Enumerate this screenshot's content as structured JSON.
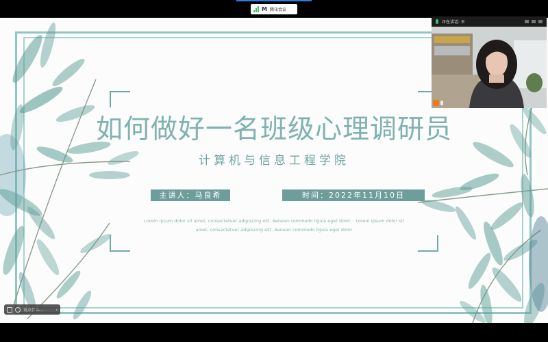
{
  "meeting_bar": {
    "app_name": "腾讯会议",
    "logo_glyph": "M",
    "icons": {
      "signal": "signal-icon",
      "logo": "tencent-meeting-logo-icon"
    },
    "accent_color": "#2f7de1"
  },
  "slide": {
    "title": "如何做好一名班级心理调研员",
    "subtitle": "计算机与信息工程学院",
    "speaker_label": "主讲人：马良希",
    "date_label": "时间：2022年11月10日",
    "lorem_line_1": "Lorem ipsum dolor sit amet, consectetuer adipiscing elit. Aenean commodo ligula eget dolor. . Lorem ipsum dolor sit",
    "lorem_line_2": "amet, consectetuer adipiscing elit. Aenean commodo ligula eget dolor",
    "colors": {
      "title": "#7fb2b1",
      "label_bg": "#6e9e9c",
      "frame": "#8fc6c2",
      "leaf": "#5f9e98"
    }
  },
  "video_panel": {
    "speaking_text": "正在讲话: 王",
    "participant_name": "",
    "icons": {
      "mic": "mic-icon",
      "user": "user-icon"
    }
  },
  "toolbar": {
    "chat_placeholder": "说点什么...",
    "collapse_glyph": "‹",
    "icons": [
      "screen-icon",
      "chat-icon",
      "collapse-icon"
    ]
  }
}
